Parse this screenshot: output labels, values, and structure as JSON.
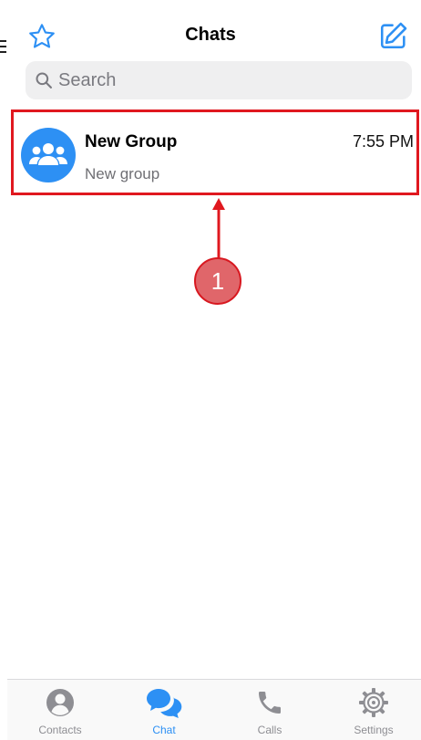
{
  "header": {
    "title": "Chats",
    "favorites_icon": "star-outline-icon",
    "compose_icon": "compose-icon"
  },
  "search": {
    "placeholder": "Search",
    "value": "",
    "icon": "search-icon"
  },
  "chats": [
    {
      "name": "New Group",
      "time": "7:55 PM",
      "preview": "New group",
      "avatar_icon": "group-icon",
      "highlighted": true
    }
  ],
  "annotation": {
    "step_number": "1",
    "color": "#e0181f"
  },
  "tabbar": {
    "items": [
      {
        "label": "Contacts",
        "icon": "person-icon",
        "active": false
      },
      {
        "label": "Chat",
        "icon": "chat-bubbles-icon",
        "active": true
      },
      {
        "label": "Calls",
        "icon": "phone-icon",
        "active": false
      },
      {
        "label": "Settings",
        "icon": "gear-icon",
        "active": false
      }
    ]
  },
  "colors": {
    "accent": "#2d90f4",
    "highlight": "#e0181f",
    "marker_fill": "#e0666a",
    "inactive": "#8e8e93",
    "search_bg": "#efeff0"
  }
}
